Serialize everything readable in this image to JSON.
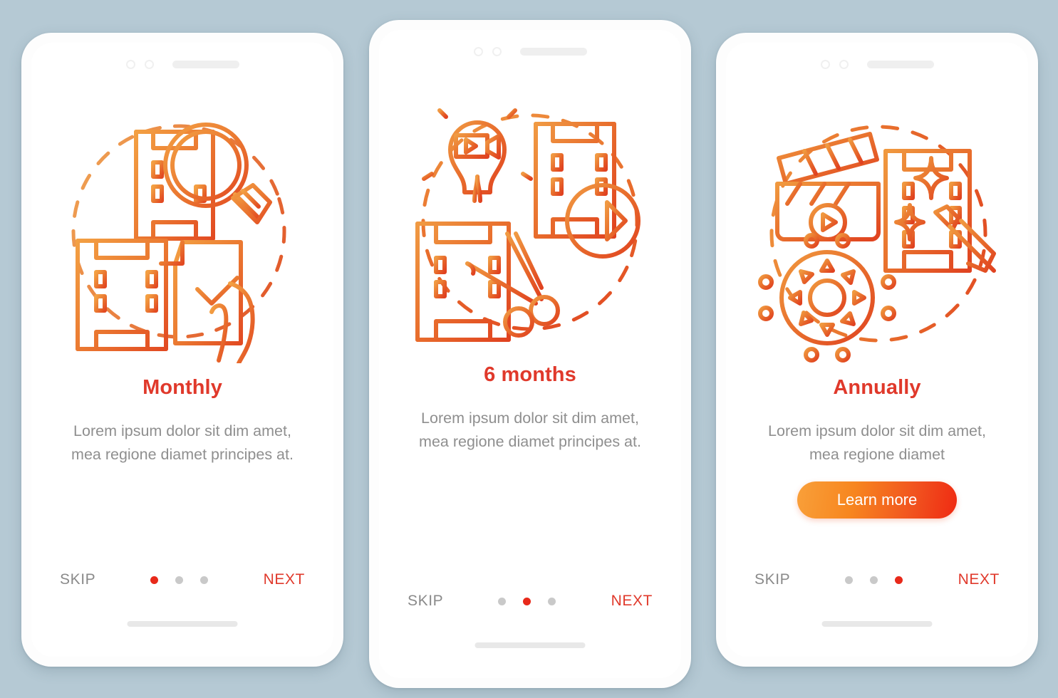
{
  "background_color": "#b5c9d4",
  "accent": {
    "title_color": "#e0392b",
    "next_color": "#e0392b",
    "skip_color": "#8a8a8a",
    "dot_active_color": "#e8291a",
    "dot_inactive_color": "#c9c9c9",
    "icon_gradient_from": "#f3933b",
    "icon_gradient_to": "#e24a22",
    "cta_gradient_from": "#f9a03a",
    "cta_gradient_to": "#ef2a12"
  },
  "screens": [
    {
      "id": "monthly",
      "title": "Monthly",
      "description": "Lorem ipsum dolor sit dim amet, mea regione diamet principes at.",
      "illustration_name": "film-search-approval-illustration",
      "has_cta": false,
      "cta_label": "",
      "skip_label": "SKIP",
      "next_label": "NEXT",
      "dots": [
        true,
        false,
        false
      ],
      "active_step": 1,
      "total_steps": 3
    },
    {
      "id": "six-months",
      "title": "6 months",
      "description": "Lorem ipsum dolor sit dim amet, mea regione diamet principes at.",
      "illustration_name": "film-idea-cut-export-illustration",
      "has_cta": false,
      "cta_label": "",
      "skip_label": "SKIP",
      "next_label": "NEXT",
      "dots": [
        false,
        true,
        false
      ],
      "active_step": 2,
      "total_steps": 3
    },
    {
      "id": "annually",
      "title": "Annually",
      "description": "Lorem ipsum dolor sit dim amet, mea regione diamet",
      "illustration_name": "clapperboard-gear-retouch-illustration",
      "has_cta": true,
      "cta_label": "Learn more",
      "skip_label": "SKIP",
      "next_label": "NEXT",
      "dots": [
        false,
        false,
        true
      ],
      "active_step": 3,
      "total_steps": 3
    }
  ]
}
